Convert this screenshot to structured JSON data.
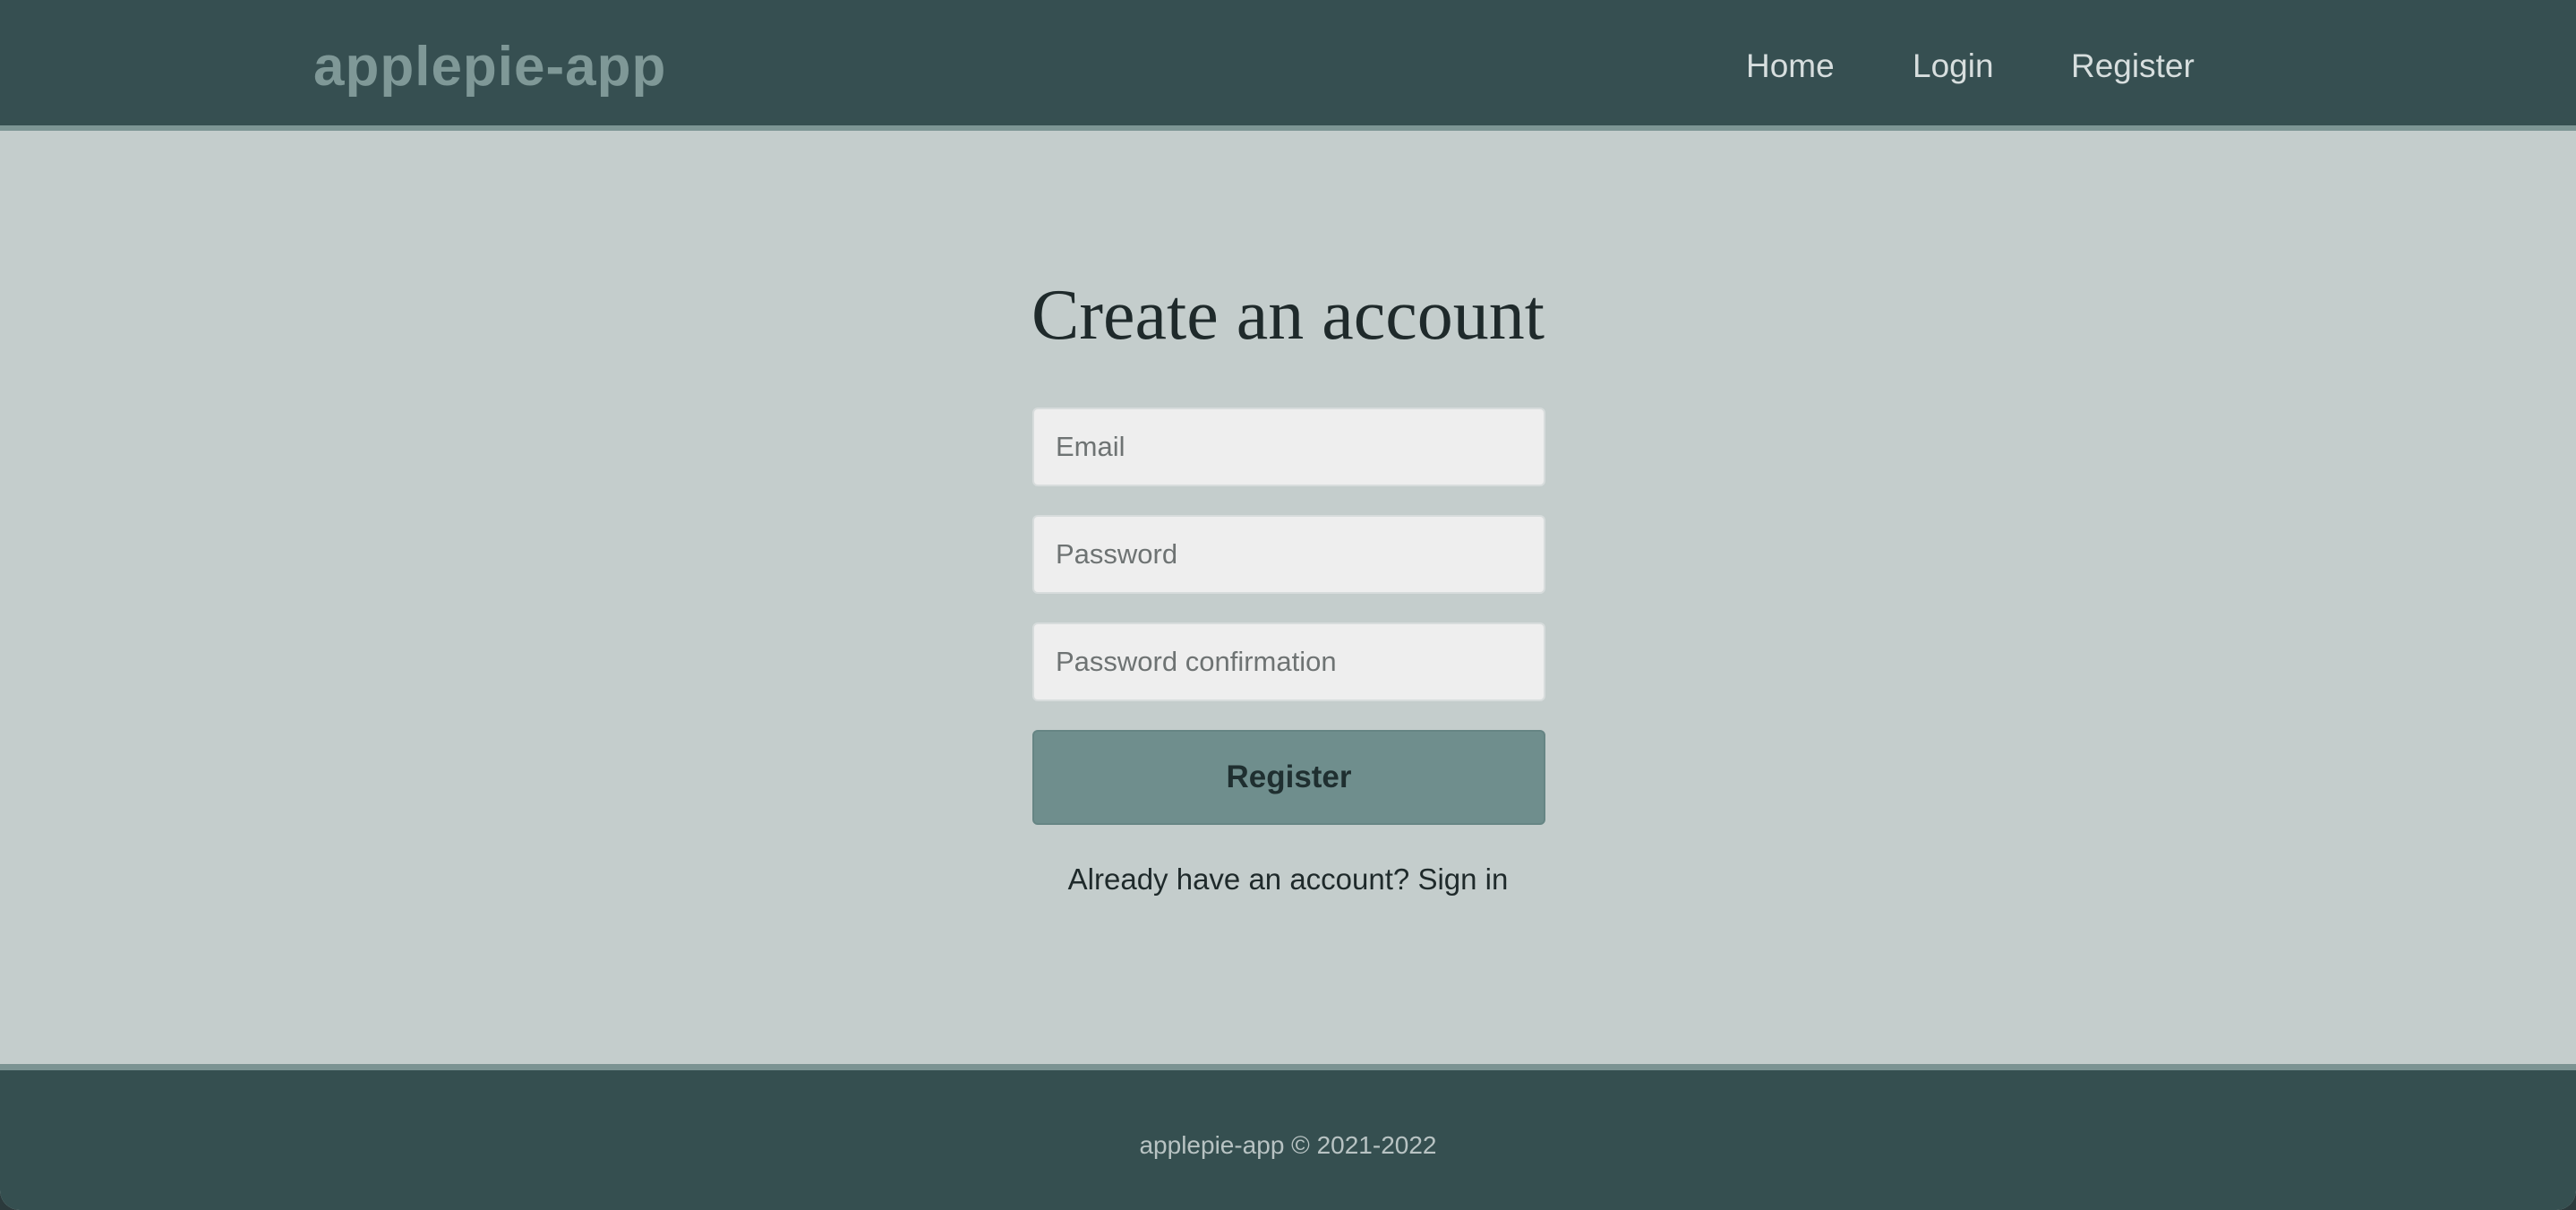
{
  "header": {
    "brand": "applepie-app",
    "nav": [
      {
        "label": "Home"
      },
      {
        "label": "Login"
      },
      {
        "label": "Register"
      }
    ]
  },
  "form": {
    "title": "Create an account",
    "email": {
      "value": "",
      "placeholder": "Email"
    },
    "password": {
      "value": "",
      "placeholder": "Password"
    },
    "password_confirmation": {
      "value": "",
      "placeholder": "Password confirmation"
    },
    "submit_label": "Register",
    "signin_prompt": "Already have an account?",
    "signin_link": "Sign in"
  },
  "footer": {
    "copyright": "applepie-app © 2021-2022"
  },
  "colors": {
    "header_bg": "#364f51",
    "page_bg": "#c4cdcc",
    "button_bg": "#6f8e8d",
    "brand_text": "#7f9897"
  }
}
